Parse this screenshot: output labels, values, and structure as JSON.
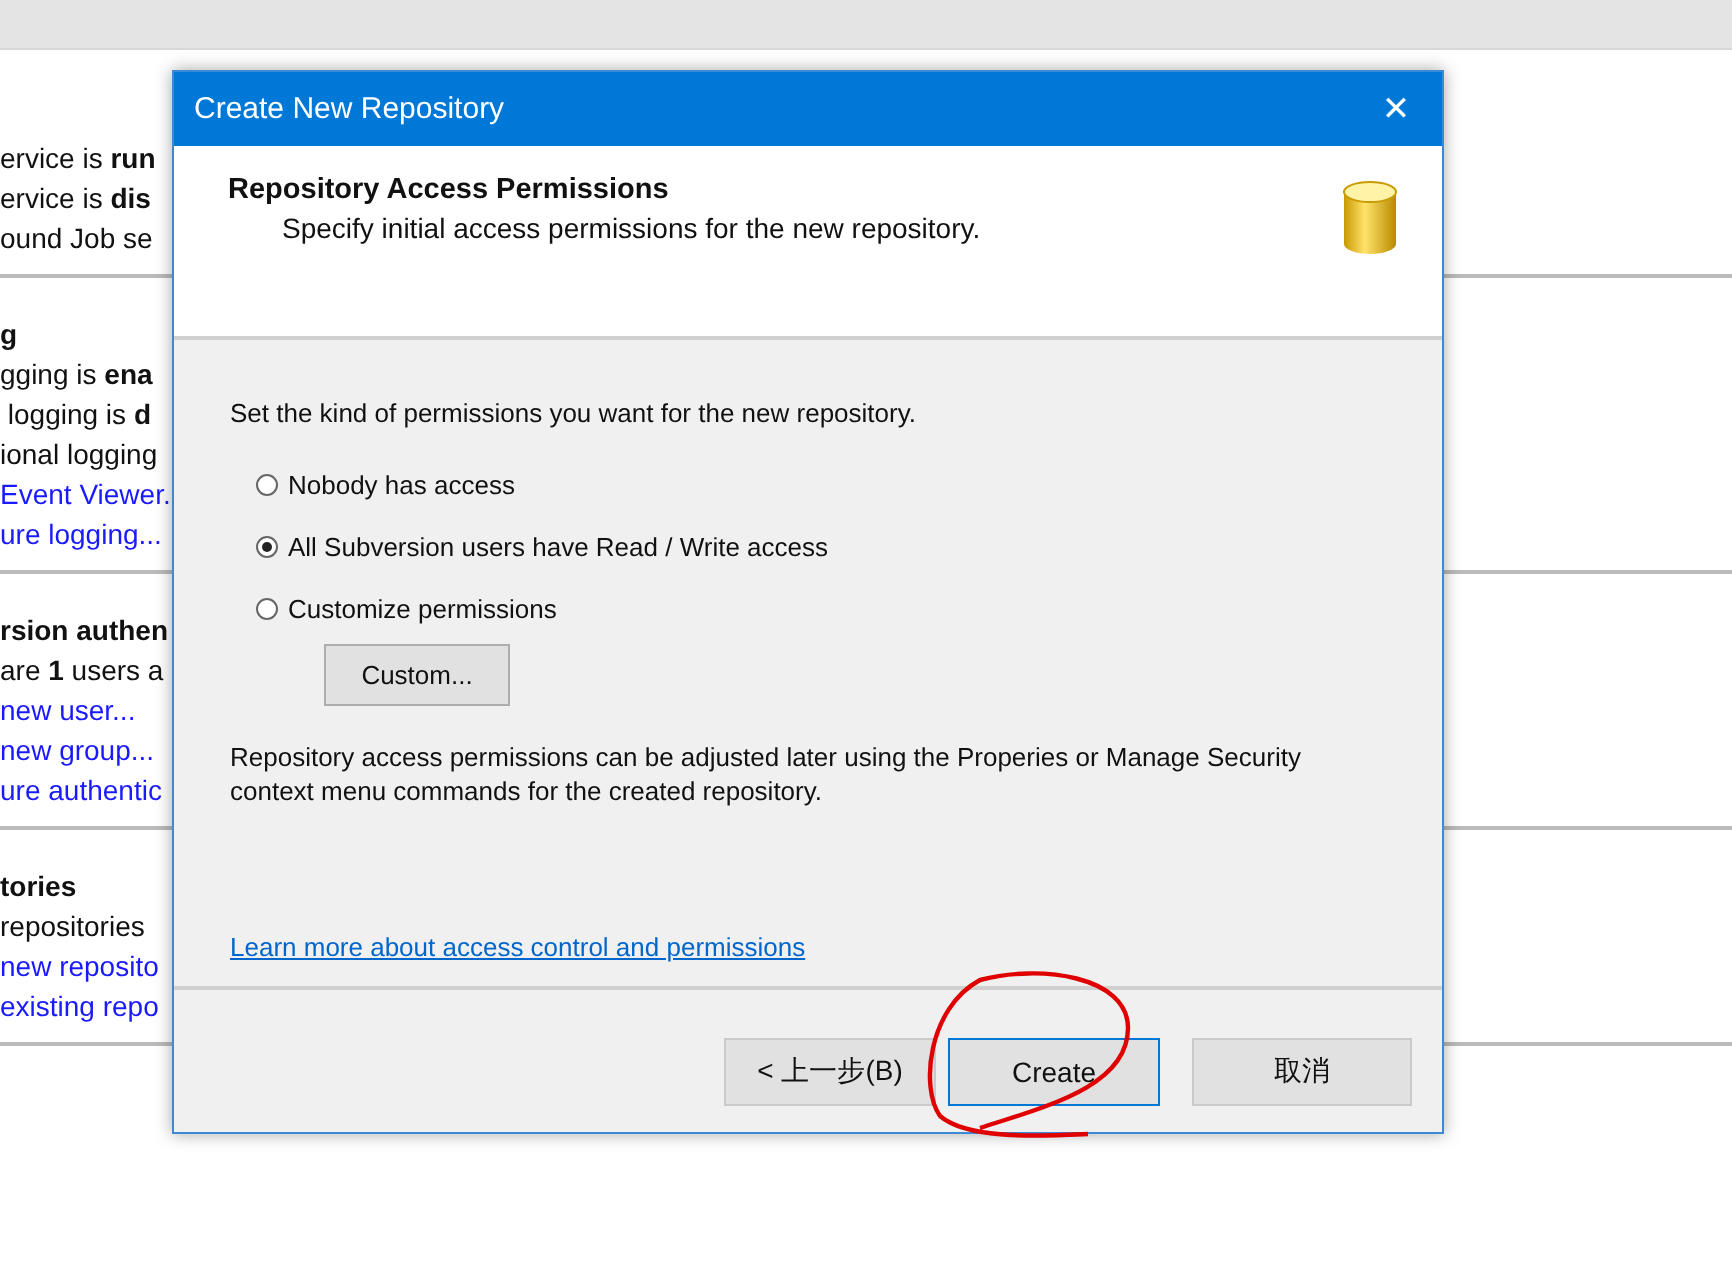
{
  "background_page": {
    "sections": [
      {
        "lines": [
          {
            "kind": "text",
            "text": "ervice is **run**"
          },
          {
            "kind": "text",
            "text": "ervice is **dis**"
          },
          {
            "kind": "text",
            "text": "ound Job se"
          }
        ]
      },
      {
        "lines": [
          {
            "kind": "heading",
            "text": "g"
          },
          {
            "kind": "text",
            "text": "gging is **ena**"
          },
          {
            "kind": "text",
            "text": " logging is **d**"
          },
          {
            "kind": "text",
            "text": "ional logging"
          },
          {
            "kind": "link",
            "text": "Event Viewer."
          },
          {
            "kind": "link",
            "text": "ure logging..."
          }
        ]
      },
      {
        "lines": [
          {
            "kind": "heading",
            "text": "rsion authen"
          },
          {
            "kind": "text",
            "text": "are **1** users a"
          },
          {
            "kind": "link",
            "text": "new user..."
          },
          {
            "kind": "link",
            "text": "new group..."
          },
          {
            "kind": "link",
            "text": "ure authentic"
          }
        ]
      },
      {
        "lines": [
          {
            "kind": "heading",
            "text": "tories"
          },
          {
            "kind": "text",
            "text": "repositories"
          },
          {
            "kind": "link",
            "text": "new reposito"
          },
          {
            "kind": "link",
            "text": "existing repo"
          }
        ]
      }
    ]
  },
  "dialog": {
    "title": "Create New Repository",
    "close": "✕",
    "header": {
      "title": "Repository Access Permissions",
      "subtitle": "Specify initial access permissions for the new repository."
    },
    "prompt": "Set the kind of permissions you want for the new repository.",
    "options": [
      {
        "label": "Nobody has access",
        "selected": false
      },
      {
        "label": "All Subversion users have Read / Write access",
        "selected": true
      },
      {
        "label": "Customize permissions",
        "selected": false
      }
    ],
    "custom_button": "Custom...",
    "note": "Repository access permissions can be adjusted later using the Properies or Manage Security context menu commands for the created repository.",
    "link": "Learn more about access control and permissions",
    "buttons": [
      {
        "label": "< 上一步(B)",
        "focused": false
      },
      {
        "label": "Create",
        "focused": true
      },
      {
        "label": "取消",
        "focused": false
      }
    ]
  }
}
